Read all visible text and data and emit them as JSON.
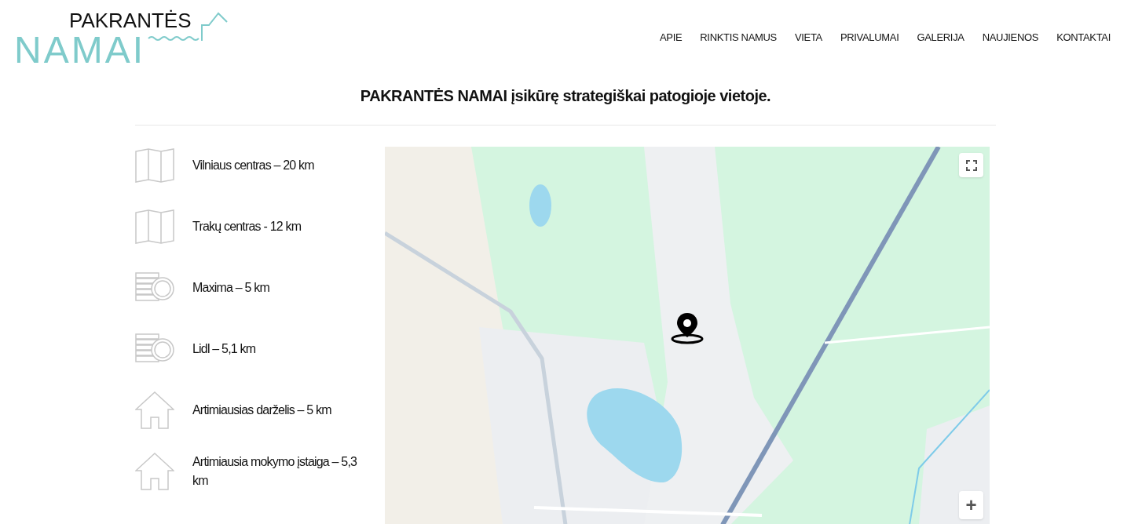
{
  "logo": {
    "line_1": "PAKRANTĖS",
    "line_2": "NAMAI"
  },
  "nav": [
    {
      "label": "APIE"
    },
    {
      "label": "RINKTIS NAMUS"
    },
    {
      "label": "VIETA"
    },
    {
      "label": "PRIVALUMAI"
    },
    {
      "label": "GALERIJA"
    },
    {
      "label": "NAUJIENOS"
    },
    {
      "label": "KONTAKTAI"
    }
  ],
  "headline": "PAKRANTĖS NAMAI įsikūrę strategiškai patogioje vietoje.",
  "distances": [
    {
      "kind": "map",
      "text": "Vilniaus centras – 20 km"
    },
    {
      "kind": "map",
      "text": "Trakų centras - 12 km"
    },
    {
      "kind": "coins",
      "text": "Maxima – 5 km"
    },
    {
      "kind": "coins",
      "text": "Lidl – 5,1 km"
    },
    {
      "kind": "house",
      "text": "Artimiausias darželis – 5 km"
    },
    {
      "kind": "house",
      "text": "Artimiausia mokymo įstaiga – 5,3 km"
    }
  ],
  "map": {
    "kind": "picture",
    "zoom_in": "+"
  }
}
